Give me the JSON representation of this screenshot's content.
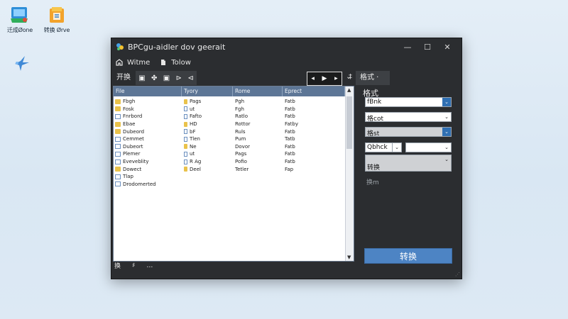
{
  "desktop": {
    "icons": [
      {
        "label": "迁成Øone",
        "icon": "converter-app-icon"
      },
      {
        "label": "转换 Ørve",
        "icon": "folder-app-icon"
      },
      {
        "label": "",
        "icon": "bird-icon"
      }
    ]
  },
  "window": {
    "title": "BPCgu-aidler dov geerait",
    "controls": {
      "minimize": "—",
      "maximize": "☐",
      "close": "✕"
    }
  },
  "menu": {
    "items": [
      {
        "label": "Witme",
        "icon": "home-icon"
      },
      {
        "label": "Tolow",
        "icon": "file-icon"
      }
    ]
  },
  "toolbar": {
    "main_tab": "开换",
    "tools": [
      "▣",
      "✤",
      "▣",
      "⊳",
      "⊲"
    ],
    "player": {
      "left": "◂",
      "play": "▶",
      "right": "▸"
    },
    "down_glyph": "⌄",
    "sort_glyph": "‡",
    "format_tab": "格式 ·"
  },
  "files": {
    "columns": [
      "File",
      "Tyory",
      "Rome",
      "Eprect"
    ],
    "rows": [
      {
        "name": "Fbgh",
        "type": "Pags",
        "rome": "Pgh",
        "ext": "Fatb",
        "icon": "folder"
      },
      {
        "name": "Fosk",
        "type": "ut",
        "rome": "Fgh",
        "ext": "Fatb",
        "icon": "folder"
      },
      {
        "name": "Fnrbord",
        "type": "Fafto",
        "rome": "Ratlo",
        "ext": "Fatb",
        "icon": "doc"
      },
      {
        "name": "Ebae",
        "type": "HD",
        "rome": "Rottor",
        "ext": "Fatby",
        "icon": "folder"
      },
      {
        "name": "Dubeord",
        "type": "bF",
        "rome": "Ruls",
        "ext": "Fatb",
        "icon": "folder"
      },
      {
        "name": "Cemmet",
        "type": "Tlen",
        "rome": "Pum",
        "ext": "Tatb",
        "icon": "doc"
      },
      {
        "name": "Dubeort",
        "type": "Ne",
        "rome": "Dovor",
        "ext": "Fatb",
        "icon": "doc"
      },
      {
        "name": "Plemer",
        "type": "ut",
        "rome": "Pags",
        "ext": "Fatb",
        "icon": "doc"
      },
      {
        "name": "Eveveblity",
        "type": "R Ag",
        "rome": "Pofio",
        "ext": "Fatb",
        "icon": "doc"
      },
      {
        "name": "Dowect",
        "type": "Deel",
        "rome": "Tetler",
        "ext": "Fap",
        "icon": "folder"
      },
      {
        "name": "Tlap",
        "type": "",
        "rome": "",
        "ext": "",
        "icon": "doc"
      },
      {
        "name": "Drodomerted",
        "type": "",
        "rome": "",
        "ext": "",
        "icon": "doc"
      }
    ]
  },
  "status": [
    "换",
    "♯",
    "…"
  ],
  "format_panel": {
    "label": "格式",
    "fields": [
      {
        "value": "fBnk",
        "style": "white",
        "dropdown": "blue"
      },
      {
        "value": "格cot",
        "style": "white",
        "dropdown": "plain"
      },
      {
        "value": "格st",
        "style": "grey",
        "dropdown": "blue"
      },
      {
        "value": "Qbhck",
        "style": "white",
        "dropdown": "plain"
      },
      {
        "value": "",
        "style": "white",
        "dropdown": "plain"
      },
      {
        "value": "转换",
        "style": "grey",
        "dropdown": "plain"
      }
    ],
    "hint": "换m",
    "convert_button": "转换"
  },
  "colors": {
    "accent": "#4d84c4",
    "header_blue": "#5d7696",
    "window_bg": "#2b2d30"
  }
}
